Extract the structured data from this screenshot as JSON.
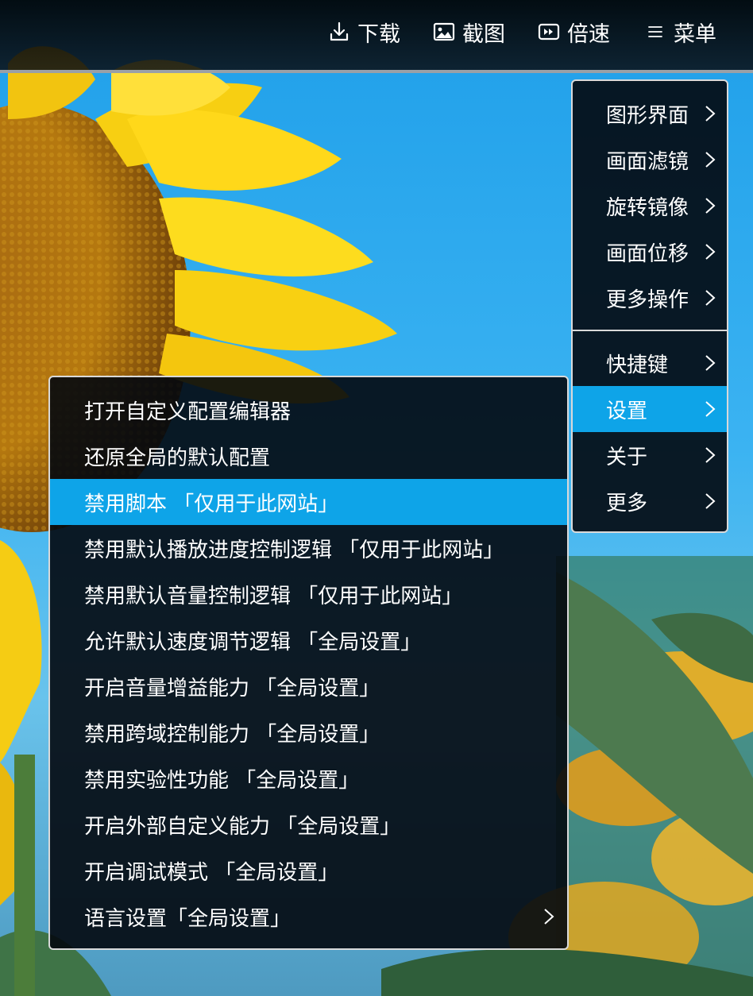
{
  "toolbar": {
    "download": "下载",
    "screenshot": "截图",
    "speed": "倍速",
    "menu": "菜单"
  },
  "main_menu": {
    "group1": [
      {
        "label": "图形界面"
      },
      {
        "label": "画面滤镜"
      },
      {
        "label": "旋转镜像"
      },
      {
        "label": "画面位移"
      },
      {
        "label": "更多操作"
      }
    ],
    "group2": [
      {
        "label": "快捷键"
      },
      {
        "label": "设置",
        "active": true
      },
      {
        "label": "关于"
      },
      {
        "label": "更多"
      }
    ]
  },
  "settings_submenu": {
    "items": [
      {
        "label": "打开自定义配置编辑器"
      },
      {
        "label": "还原全局的默认配置"
      },
      {
        "label": "禁用脚本 「仅用于此网站」",
        "active": true
      },
      {
        "label": "禁用默认播放进度控制逻辑 「仅用于此网站」"
      },
      {
        "label": "禁用默认音量控制逻辑 「仅用于此网站」"
      },
      {
        "label": "允许默认速度调节逻辑 「全局设置」"
      },
      {
        "label": "开启音量增益能力 「全局设置」"
      },
      {
        "label": "禁用跨域控制能力 「全局设置」"
      },
      {
        "label": "禁用实验性功能 「全局设置」"
      },
      {
        "label": "开启外部自定义能力 「全局设置」"
      },
      {
        "label": "开启调试模式 「全局设置」"
      },
      {
        "label": "语言设置「全局设置」",
        "has_submenu": true
      }
    ]
  },
  "colors": {
    "highlight": "#0ea4e8",
    "menu_bg": "#03080e",
    "menu_border": "#d9d9d9",
    "text": "#ffffff"
  }
}
